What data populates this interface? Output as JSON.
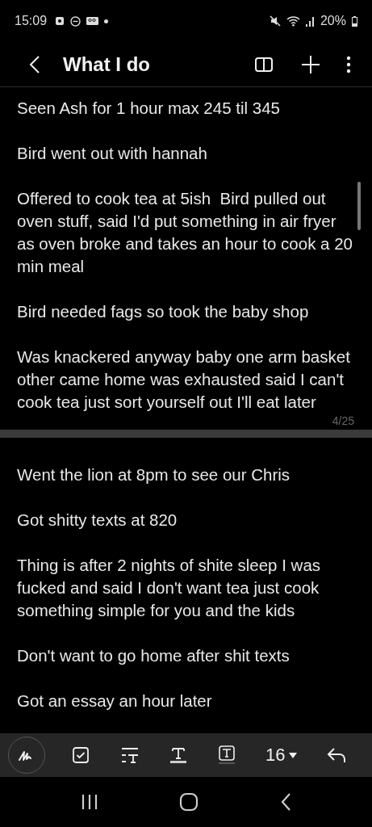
{
  "status_bar": {
    "time": "15:09",
    "battery": "20%"
  },
  "header": {
    "title": "What I do"
  },
  "pages": [
    {
      "paragraphs": [
        "Seen Ash for 1 hour max 245 til 345",
        "Bird went out with hannah",
        "Offered to cook tea at 5ish  Bird pulled out oven stuff, said I'd put something in air fryer as oven broke and takes an hour to cook a 20 min meal",
        "Bird needed fags so took the baby shop",
        "Was knackered anyway baby one arm basket other came home was exhausted said I can't cook tea just sort yourself out I'll eat later"
      ],
      "page_number": "4/25"
    },
    {
      "paragraphs": [
        "Went the lion at 8pm to see our Chris",
        "Got shitty texts at 820",
        "Thing is after 2 nights of shite sleep I was fucked and said I don't want tea just cook something simple for you and the kids",
        "Don't want to go home after shit texts",
        "Got an essay an hour later"
      ]
    }
  ],
  "toolbar": {
    "font_size": "16"
  }
}
